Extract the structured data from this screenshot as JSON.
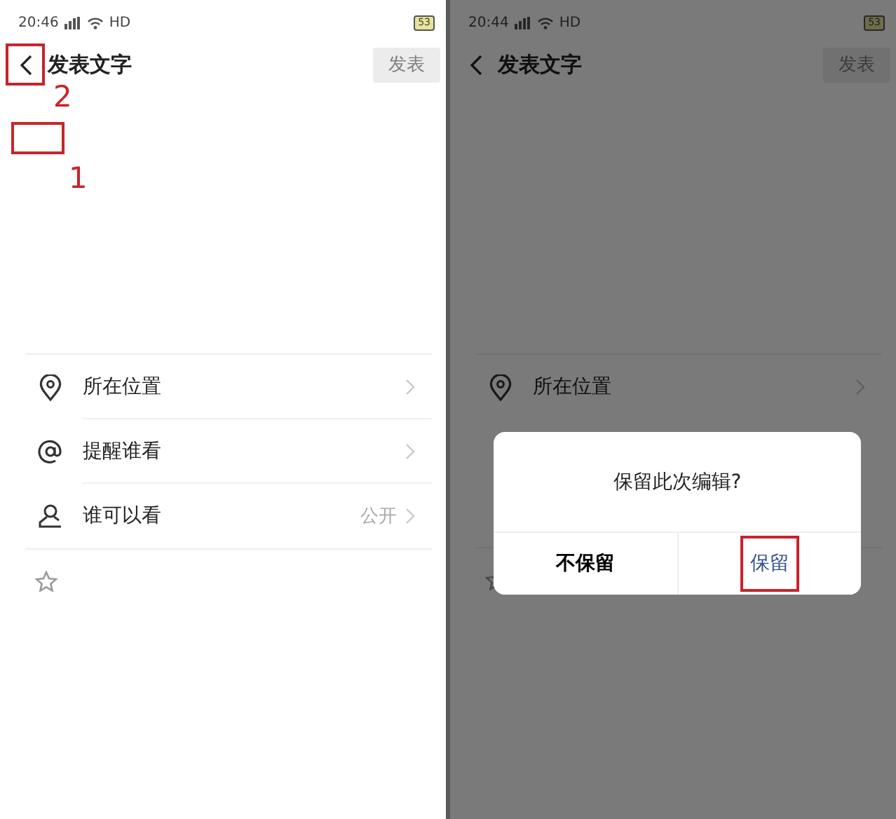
{
  "screens": [
    {
      "status_bar": {
        "time": "20:46",
        "network": "HD",
        "battery": "53"
      },
      "header": {
        "back_highlighted": true,
        "back_annotation": "2",
        "title": "发表文字",
        "publish": "发表"
      },
      "text_area": {
        "highlighted": true,
        "annotation": "1"
      },
      "rows": [
        {
          "kind": "location",
          "label": "所在位置"
        },
        {
          "kind": "mention",
          "label": "提醒谁看"
        },
        {
          "kind": "person",
          "label": "谁可以看",
          "value": "公开"
        }
      ]
    },
    {
      "status_bar": {
        "time": "20:44",
        "network": "HD",
        "battery": "53"
      },
      "header": {
        "back_highlighted": false,
        "title": "发表文字",
        "publish": "发表"
      },
      "rows": [
        {
          "kind": "location",
          "label": "所在位置"
        }
      ],
      "dialog": {
        "message": "保留此次编辑?",
        "buttons": [
          {
            "label": "不保留",
            "highlighted": false
          },
          {
            "label": "保留",
            "highlighted": true
          }
        ]
      }
    }
  ]
}
